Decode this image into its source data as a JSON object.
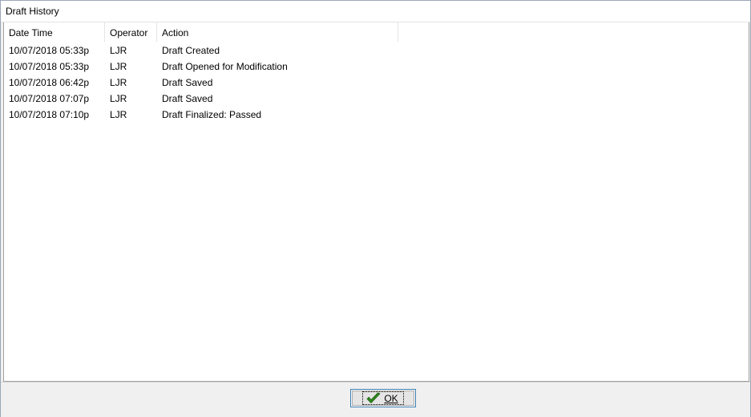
{
  "window": {
    "title": "Draft History"
  },
  "table": {
    "columns": [
      "Date Time",
      "Operator",
      "Action"
    ],
    "rows": [
      {
        "datetime": "10/07/2018 05:33p",
        "operator": "LJR",
        "action": "Draft Created"
      },
      {
        "datetime": "10/07/2018 05:33p",
        "operator": "LJR",
        "action": "Draft Opened for Modification"
      },
      {
        "datetime": "10/07/2018 06:42p",
        "operator": "LJR",
        "action": "Draft Saved"
      },
      {
        "datetime": "10/07/2018 07:07p",
        "operator": "LJR",
        "action": "Draft Saved"
      },
      {
        "datetime": "10/07/2018 07:10p",
        "operator": "LJR",
        "action": "Draft Finalized: Passed"
      }
    ]
  },
  "footer": {
    "ok_label": "OK",
    "ok_icon": "green-checkmark-icon"
  },
  "colors": {
    "accent_border": "#3c7fb1",
    "check_green": "#2e8b1e"
  }
}
